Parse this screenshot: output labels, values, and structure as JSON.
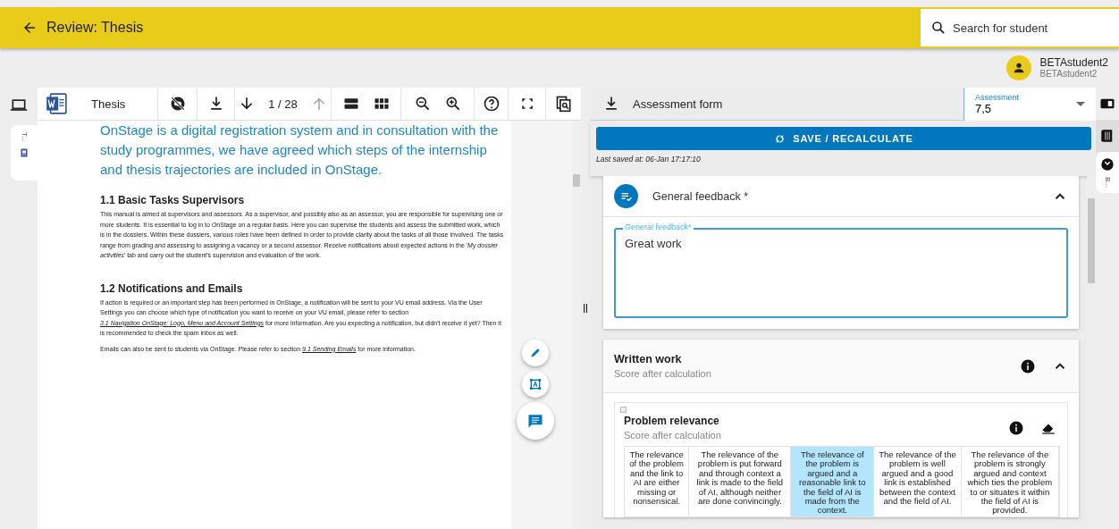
{
  "header": {
    "title": "Review: Thesis",
    "search": {
      "placeholder": "Search for student"
    }
  },
  "user": {
    "name": "BETAstudent2",
    "subtitle": "BETAstudent2"
  },
  "document": {
    "side_tab_label": "T...",
    "toolbar": {
      "filename": "Thesis",
      "page": "1 / 28"
    },
    "intro": "OnStage is a digital registration system and in consultation with the study programmes, we have agreed which steps of the internship and thesis trajectories are included in OnStage.",
    "sections": [
      {
        "heading": "1.1 Basic Tasks Supervisors",
        "paragraphs": [
          [
            {
              "kind": "text",
              "text": "This manual is aimed at supervisors and assessors. As a supervisor, and possibly also as an assessor, you are responsible for supervising one or more students. It is essential to log in to OnStage on a regular basis. Here you can supervise the students and assess the submitted work, which is in the dossiers. Within these dossiers, various roles have been defined in order to provide clarity about the tasks of all those involved. The tasks range from grading and assessing to assigning a vacancy or a second assessor. Receive notifications about expected actions in the '*My dossier activities*' tab and carry out the student's supervision and evaluation of the work."
            }
          ]
        ]
      },
      {
        "heading": "1.2 Notifications and Emails",
        "paragraphs": [
          [
            {
              "kind": "text",
              "text": "If action is required or an important step has been performed in OnStage, a notification will be sent to your VU email address. Via the User Settings you can choose which type of notification you want to receive on your VU email, please refer to section "
            },
            {
              "kind": "link",
              "text": "3.1 Navigation OnStage: Logo, Menu and Account Settings"
            },
            {
              "kind": "text",
              "text": " for more information. Are you expecting a notification, but didn't receive it yet? Then it is recommended to check the spam inbox as well."
            }
          ],
          [
            {
              "kind": "text",
              "text": "Emails can also be sent to students via OnStage. Please refer to section "
            },
            {
              "kind": "link",
              "text": "9.1 Sending Emails"
            },
            {
              "kind": "text",
              "text": " for more information."
            }
          ]
        ]
      }
    ]
  },
  "assessment_form": {
    "title": "Assessment form",
    "grade": {
      "label": "Assessment",
      "value": "7,5"
    },
    "save_button": "SAVE / RECALCULATE",
    "last_saved": "Last saved at: 06-Jan 17:17:10",
    "side_tab_label": "B..."
  },
  "feedback": {
    "title": "General feedback *",
    "expanded": true,
    "field": {
      "label": "General feedback*",
      "value": "Great work"
    }
  },
  "written_work": {
    "title": "Written work",
    "subtitle": "Score after calculation",
    "expanded": true,
    "criteria": [
      {
        "title": "Problem relevance",
        "subtitle": "Score after calculation",
        "levels": [
          {
            "text": "The relevance of the problem and the link to AI are either missing or nonsensical.",
            "selected": false
          },
          {
            "text": "The relevance of the problem is put forward and through context a link is made to the field of AI, although neither are done convincingly.",
            "selected": false
          },
          {
            "text": "The relevance of the problem is argued and a reasonable link to the field of AI is made from the context.",
            "selected": true
          },
          {
            "text": "The relevance of the problem is well argued and a good link is established between the context and the field of AI.",
            "selected": false
          },
          {
            "text": "The relevance of the problem is strongly argued and context which ties the problem to or situates it within the field of AI is provided.",
            "selected": false
          }
        ]
      }
    ]
  }
}
